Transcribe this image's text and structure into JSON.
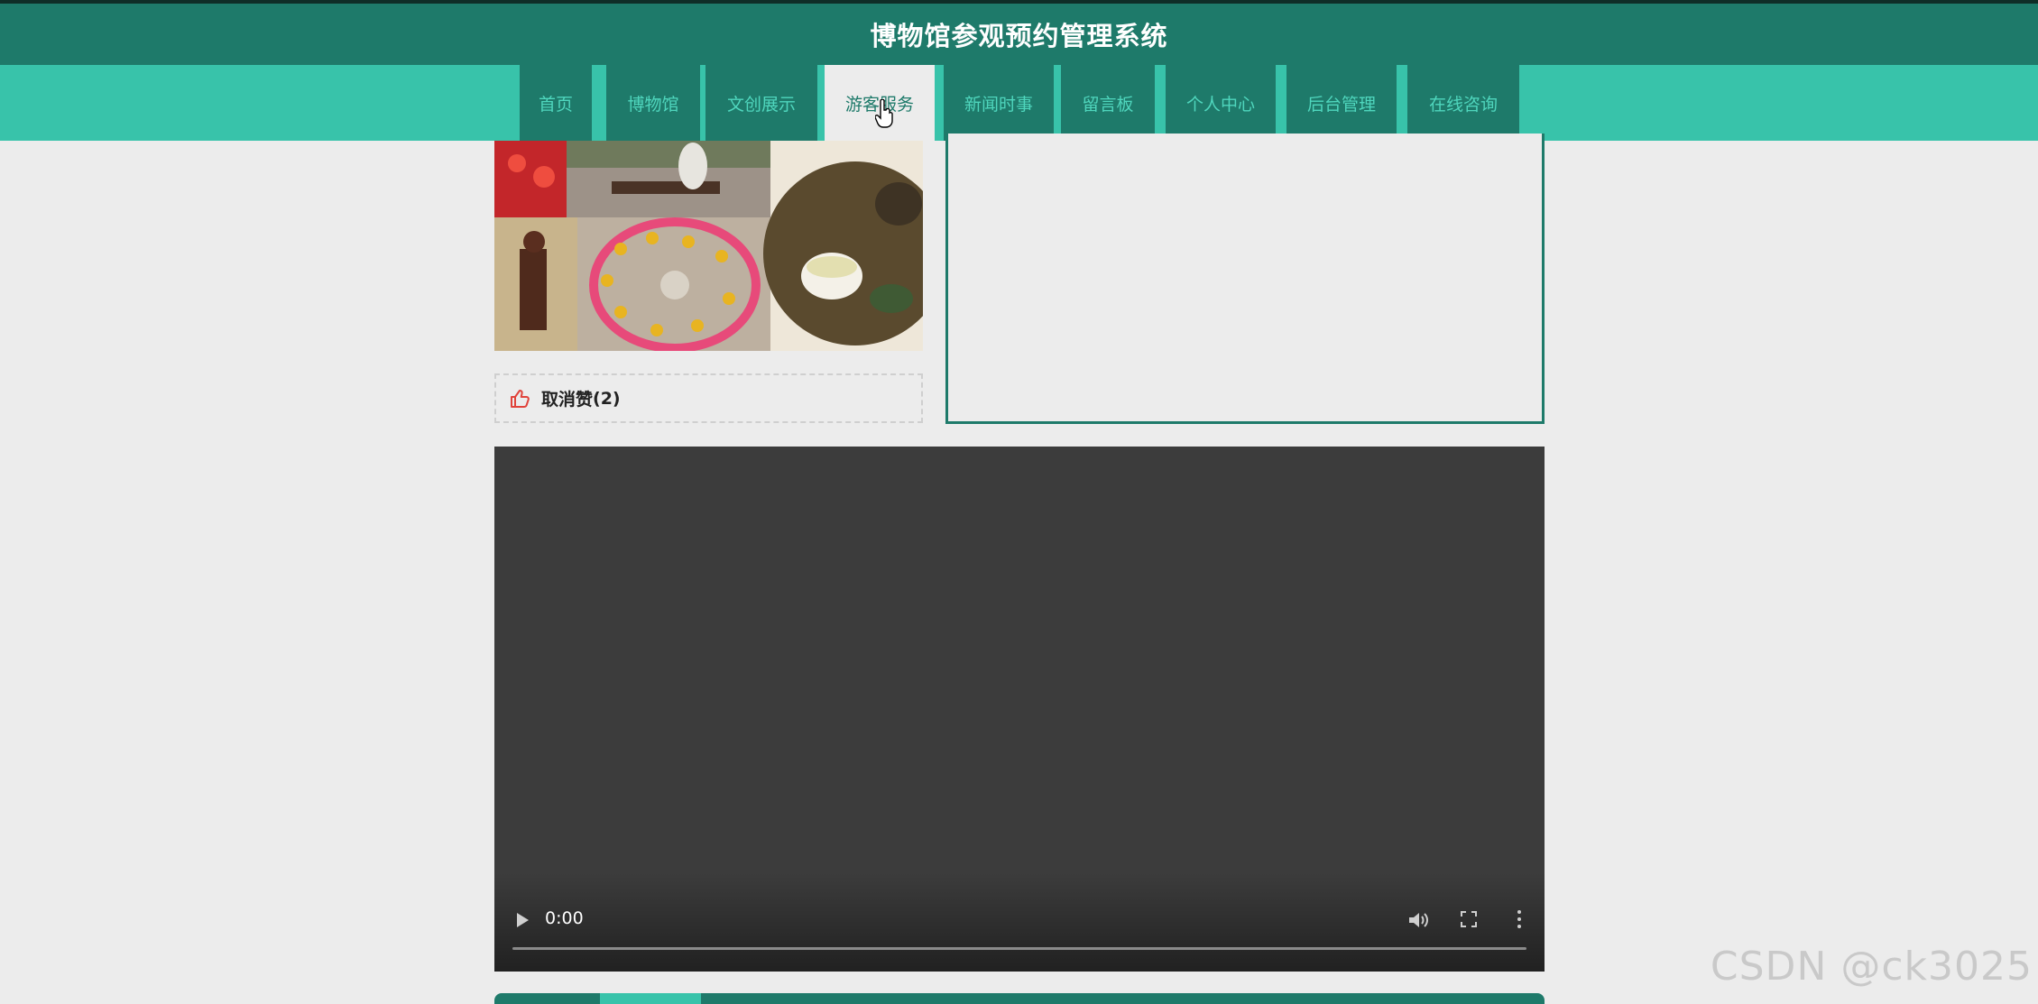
{
  "header": {
    "title": "博物馆参观预约管理系统"
  },
  "nav": {
    "items": [
      {
        "label": "首页"
      },
      {
        "label": "博物馆"
      },
      {
        "label": "文创展示"
      },
      {
        "label": "游客服务"
      },
      {
        "label": "新闻时事"
      },
      {
        "label": "留言板"
      },
      {
        "label": "个人中心"
      },
      {
        "label": "后台管理"
      },
      {
        "label": "在线咨询"
      }
    ],
    "active_index": 3
  },
  "like": {
    "label": "取消赞",
    "count_text": "(2)"
  },
  "video": {
    "time": "0:00",
    "progress": 0
  },
  "watermark": "CSDN @ck3025",
  "colors": {
    "primary_dark": "#1e7a6a",
    "primary_light": "#38c3aa",
    "background": "#ececec",
    "video_bg": "#3c3c3c",
    "like_icon": "#e0433b"
  },
  "icons": [
    "thumbs-up-icon",
    "play-icon",
    "volume-icon",
    "fullscreen-icon",
    "more-menu-icon",
    "hand-pointer-icon"
  ]
}
